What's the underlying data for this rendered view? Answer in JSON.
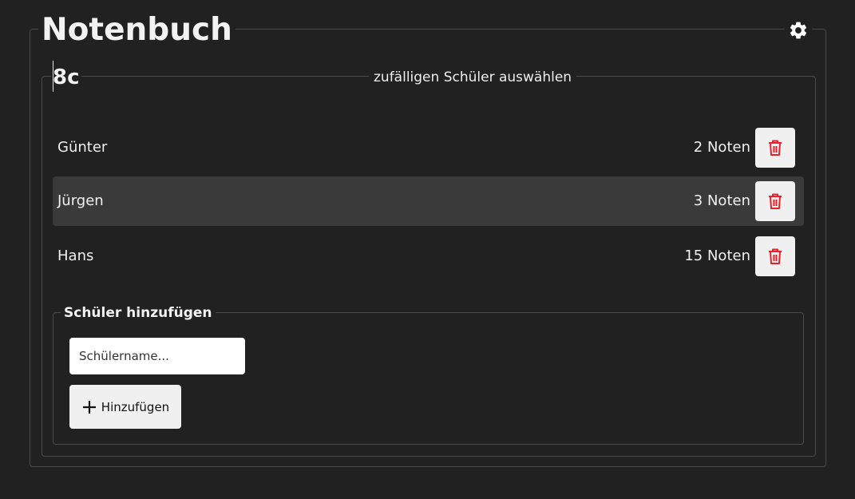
{
  "header": {
    "title": "Notenbuch",
    "settings_icon": "gear-icon"
  },
  "class_panel": {
    "name": "8c",
    "random_student_label": "zufälligen Schüler auswählen"
  },
  "students": [
    {
      "name": "Günter",
      "grades": "2 Noten",
      "highlighted": false
    },
    {
      "name": "Jürgen",
      "grades": "3 Noten",
      "highlighted": true
    },
    {
      "name": "Hans",
      "grades": "15 Noten",
      "highlighted": false
    }
  ],
  "add_student": {
    "legend": "Schüler hinzufügen",
    "input_placeholder": "Schülername...",
    "input_value": "",
    "button_label": "Hinzufügen",
    "button_icon": "plus-icon"
  },
  "colors": {
    "background": "#212121",
    "border": "#4a4a4a",
    "row_highlight": "#3a3a3a",
    "delete_icon": "#e8202a",
    "button_bg": "#f0f0f0"
  }
}
